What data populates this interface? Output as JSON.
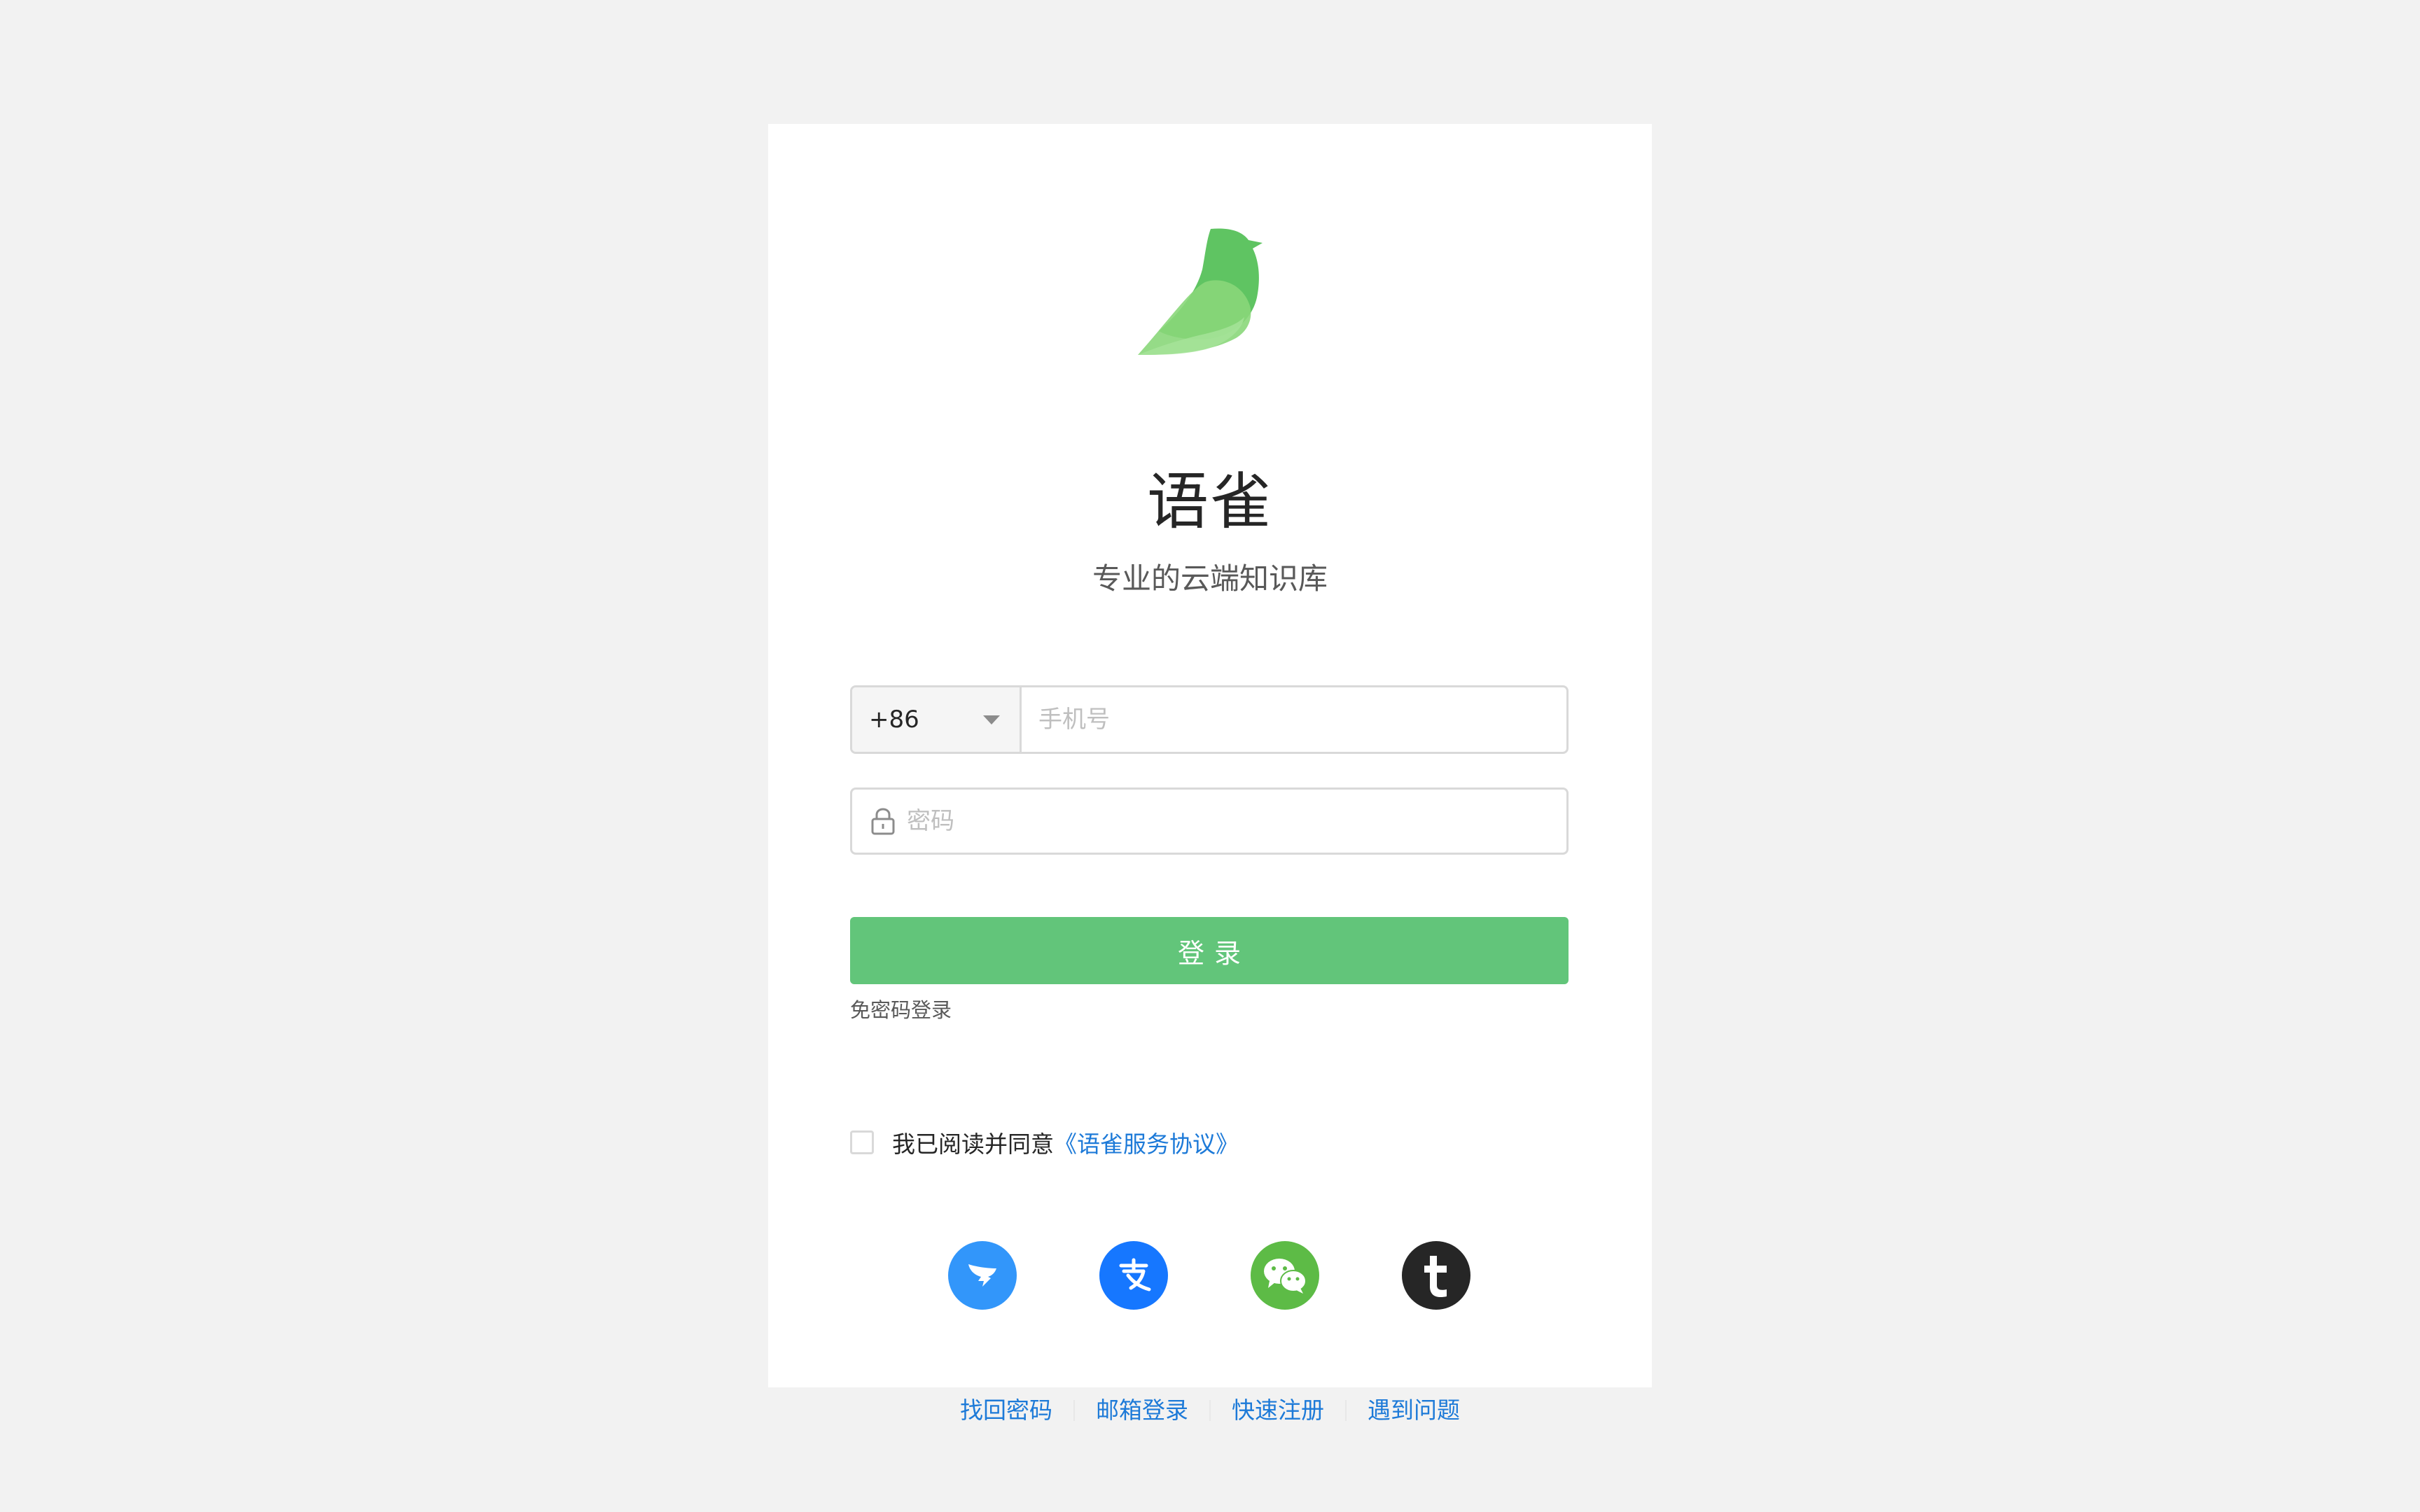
{
  "brand": {
    "name": "语雀",
    "tagline": "专业的云端知识库",
    "logo_icon": "yuque-bird-logo",
    "colors": {
      "primary_green": "#62c57a",
      "link_blue": "#1d7ad8",
      "background": "#f2f2f2"
    }
  },
  "login_form": {
    "country_code": "+86",
    "phone_placeholder": "手机号",
    "password_placeholder": "密码",
    "passwordless_label": "免密码登录",
    "submit_label": "登录"
  },
  "agreement": {
    "text": "我已阅读并同意",
    "link_label": "《语雀服务协议》",
    "checked": false
  },
  "social_logins": [
    {
      "name": "dingtalk",
      "icon": "dingtalk-icon"
    },
    {
      "name": "alipay",
      "icon": "alipay-icon"
    },
    {
      "name": "wechat",
      "icon": "wechat-icon"
    },
    {
      "name": "taobao",
      "icon": "taobao-icon"
    }
  ],
  "footer": {
    "links": [
      "找回密码",
      "邮箱登录",
      "快速注册",
      "遇到问题"
    ]
  }
}
